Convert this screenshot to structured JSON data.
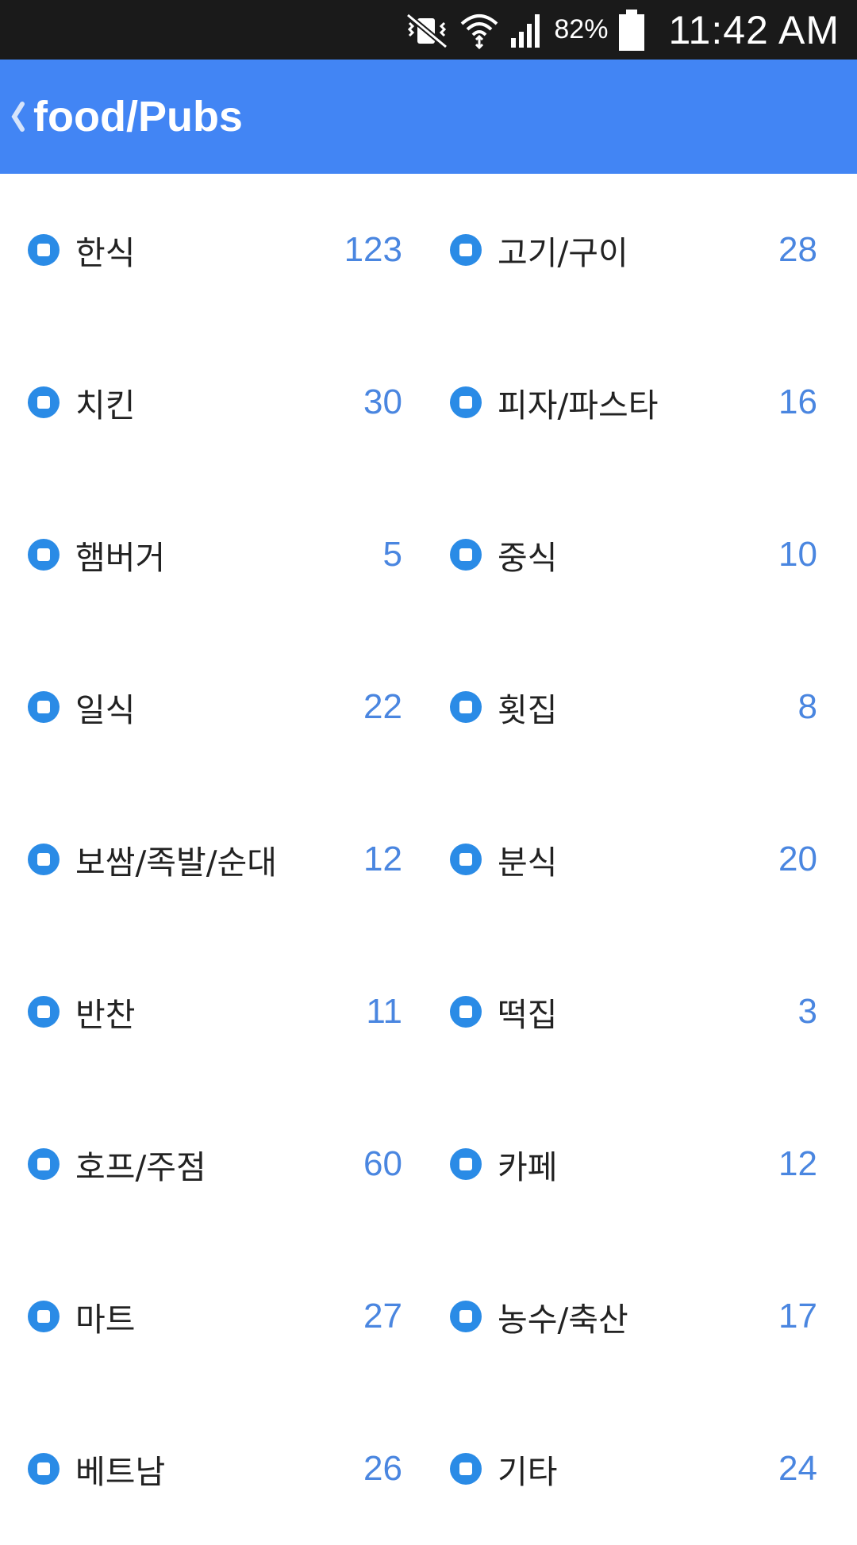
{
  "status_bar": {
    "battery_percent": "82%",
    "time": "11:42 AM",
    "icons": [
      "vibrate-mute-icon",
      "wifi-icon",
      "signal-icon",
      "battery-icon"
    ]
  },
  "header": {
    "title": "food/Pubs",
    "back_icon": "chevron-left-icon",
    "color": "#4285f4"
  },
  "categories": [
    {
      "label": "한식",
      "count": "123"
    },
    {
      "label": "고기/구이",
      "count": "28"
    },
    {
      "label": "치킨",
      "count": "30"
    },
    {
      "label": "피자/파스타",
      "count": "16"
    },
    {
      "label": "햄버거",
      "count": "5"
    },
    {
      "label": "중식",
      "count": "10"
    },
    {
      "label": "일식",
      "count": "22"
    },
    {
      "label": "횟집",
      "count": "8"
    },
    {
      "label": "보쌈/족발/순대",
      "count": "12"
    },
    {
      "label": "분식",
      "count": "20"
    },
    {
      "label": "반찬",
      "count": "11"
    },
    {
      "label": "떡집",
      "count": "3"
    },
    {
      "label": "호프/주점",
      "count": "60"
    },
    {
      "label": "카페",
      "count": "12"
    },
    {
      "label": "마트",
      "count": "27"
    },
    {
      "label": "농수/축산",
      "count": "17"
    },
    {
      "label": "베트남",
      "count": "26"
    },
    {
      "label": "기타",
      "count": "24"
    }
  ],
  "colors": {
    "accent": "#2a8be6",
    "count_text": "#4a86e0"
  }
}
